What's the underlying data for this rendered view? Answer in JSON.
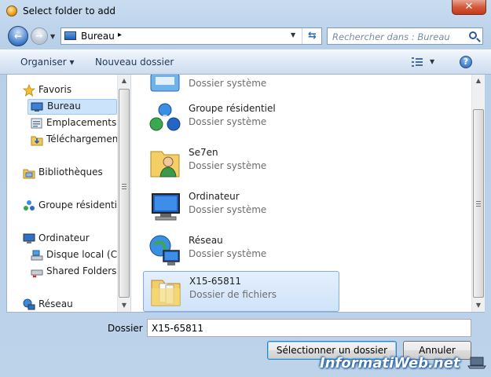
{
  "window": {
    "title": "Select folder to add",
    "close_label": "✕"
  },
  "navbar": {
    "address": {
      "location": "Bureau",
      "separator": "▸"
    },
    "search_placeholder": "Rechercher dans : Bureau"
  },
  "toolbar": {
    "organize_label": "Organiser ▾",
    "new_folder_label": "Nouveau dossier"
  },
  "nav_pane": {
    "items": [
      {
        "label": "Favoris"
      },
      {
        "label": "Bureau"
      },
      {
        "label": "Emplacements ré"
      },
      {
        "label": "Téléchargements"
      },
      {
        "label": "Bibliothèques"
      },
      {
        "label": "Groupe résidentiel"
      },
      {
        "label": "Ordinateur"
      },
      {
        "label": "Disque local (C:)"
      },
      {
        "label": "Shared Folders (\\"
      },
      {
        "label": "Réseau"
      }
    ]
  },
  "files": [
    {
      "name": "",
      "type": "Dossier système"
    },
    {
      "name": "Groupe résidentiel",
      "type": "Dossier système"
    },
    {
      "name": "Se7en",
      "type": "Dossier système"
    },
    {
      "name": "Ordinateur",
      "type": "Dossier système"
    },
    {
      "name": "Réseau",
      "type": "Dossier système"
    },
    {
      "name": "X15-65811",
      "type": "Dossier de fichiers"
    }
  ],
  "footer": {
    "folder_label": "Dossier :",
    "folder_value": "X15-65811",
    "select_button": "Sélectionner un dossier",
    "cancel_button": "Annuler"
  },
  "watermark": "InformatiWeb.net",
  "colors": {
    "selection": "#cce4fb",
    "accent": "#2a5a9c"
  }
}
